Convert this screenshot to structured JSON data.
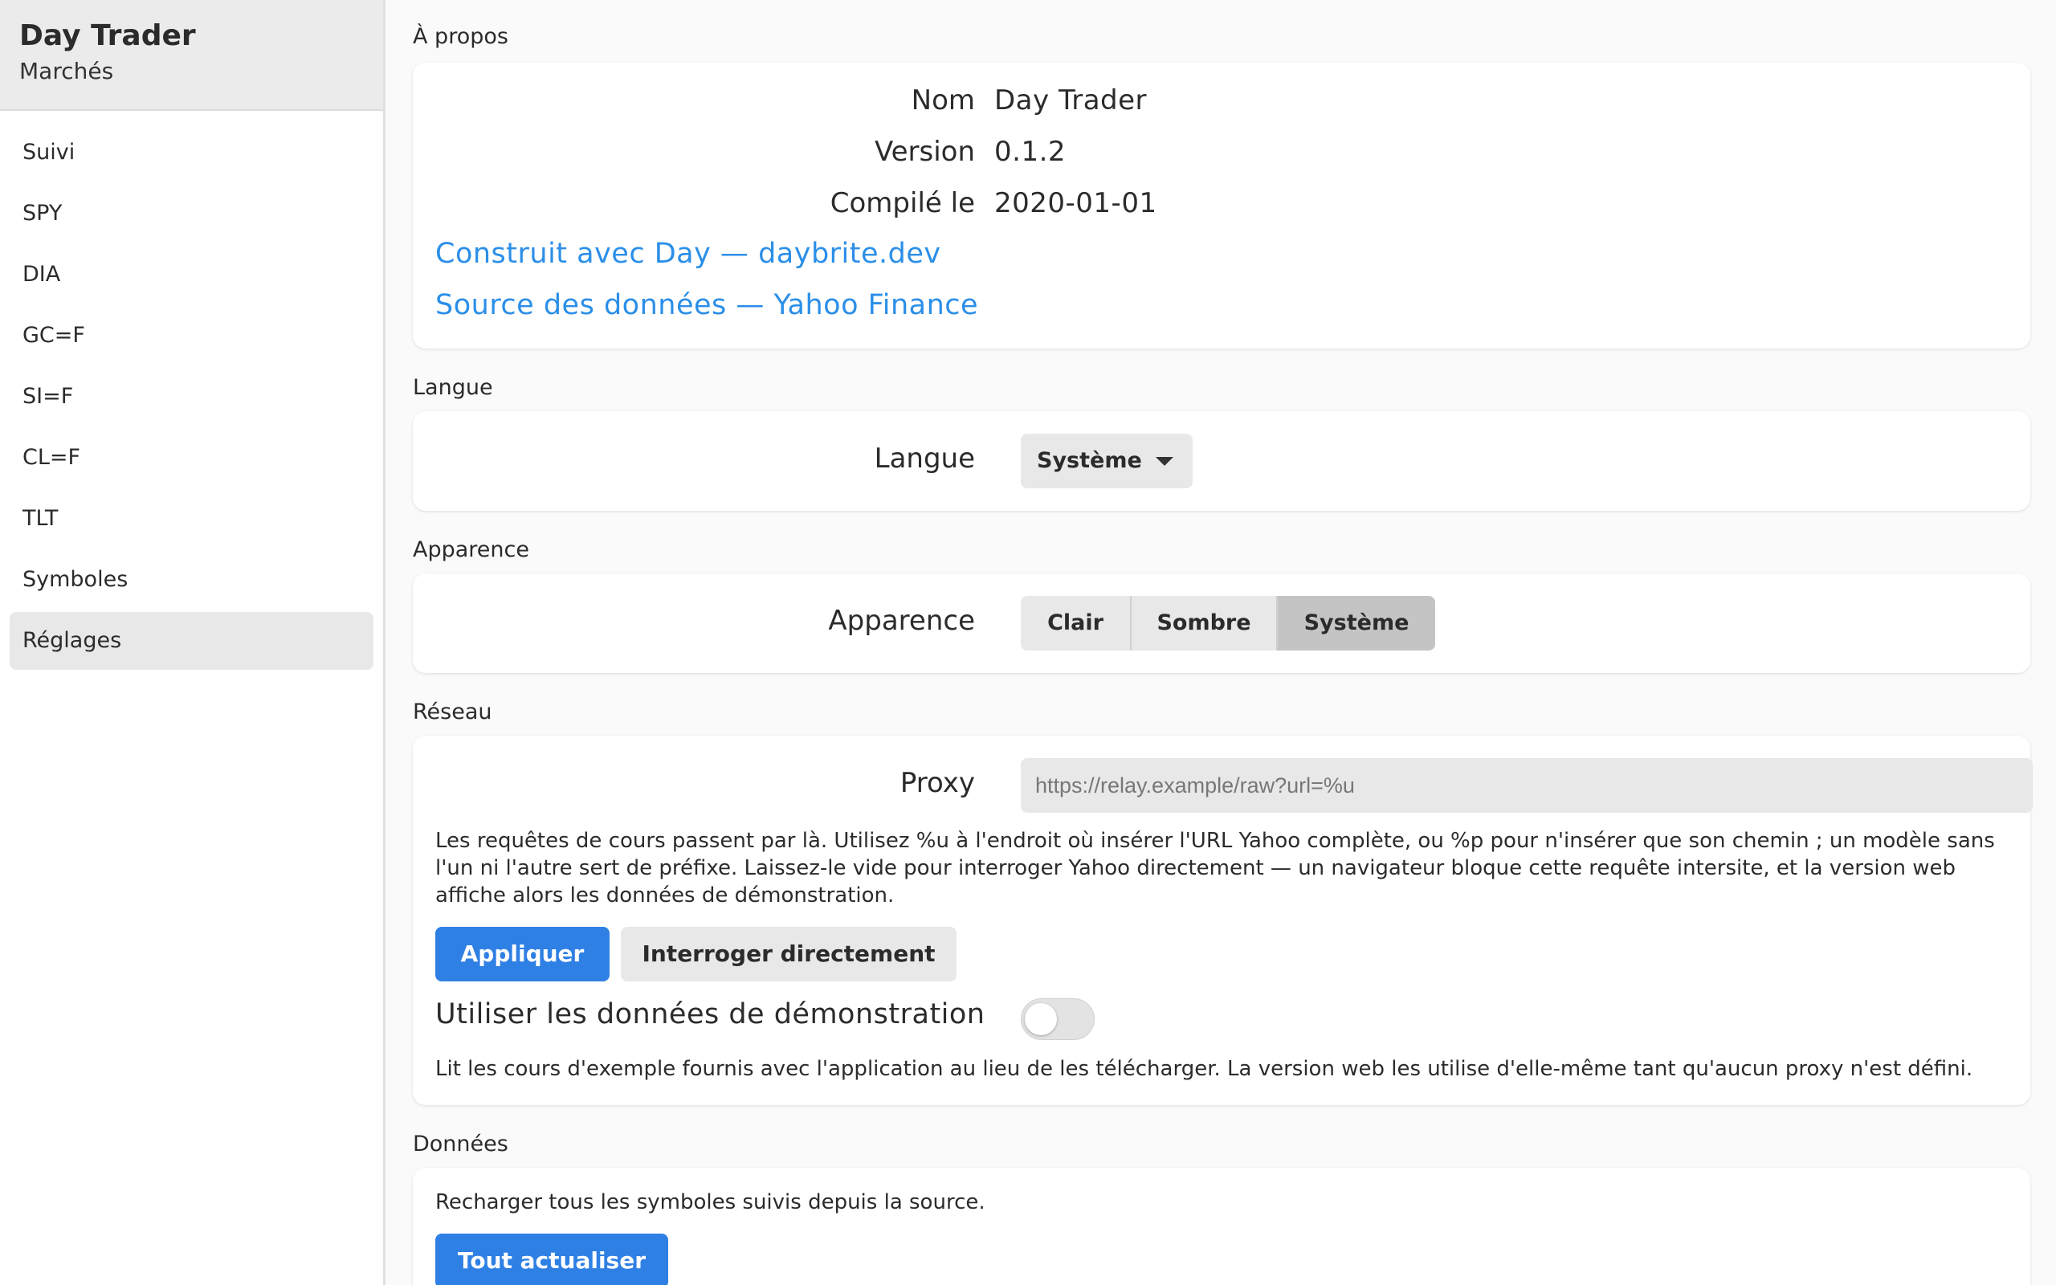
{
  "sidebar": {
    "title": "Day Trader",
    "subtitle": "Marchés",
    "items": [
      {
        "label": "Suivi"
      },
      {
        "label": "SPY"
      },
      {
        "label": "DIA"
      },
      {
        "label": "GC=F"
      },
      {
        "label": "SI=F"
      },
      {
        "label": "CL=F"
      },
      {
        "label": "TLT"
      },
      {
        "label": "Symboles"
      },
      {
        "label": "Réglages",
        "active": true
      }
    ]
  },
  "about": {
    "section": "À propos",
    "name_label": "Nom",
    "name_value": "Day Trader",
    "version_label": "Version",
    "version_value": "0.1.2",
    "compiled_label": "Compilé le",
    "compiled_value": "2020-01-01",
    "link_built": "Construit avec Day — daybrite.dev",
    "link_source": "Source des données — Yahoo Finance"
  },
  "language": {
    "section": "Langue",
    "label": "Langue",
    "selected": "Système"
  },
  "appearance": {
    "section": "Apparence",
    "label": "Apparence",
    "options": [
      "Clair",
      "Sombre",
      "Système"
    ],
    "selected": "Système"
  },
  "network": {
    "section": "Réseau",
    "proxy_label": "Proxy",
    "proxy_placeholder": "https://relay.example/raw?url=%u",
    "proxy_value": "",
    "help_lines": [
      "Les requêtes de cours passent par là. Utilisez %u à l'endroit où insérer l'URL Yahoo complète, ou %p pour n'insérer que son chemin ; un modèle sans",
      "l'un ni l'autre sert de préfixe. Laissez-le vide pour interroger Yahoo directement — un navigateur bloque cette requête intersite, et la version web",
      "affiche alors les données de démonstration."
    ],
    "apply_button": "Appliquer",
    "direct_button": "Interroger directement",
    "demo_label": "Utiliser les données de démonstration",
    "demo_enabled": false,
    "demo_help": "Lit les cours d'exemple fournis avec l'application au lieu de les télécharger. La version web les utilise d'elle-même tant qu'aucun proxy n'est défini."
  },
  "data": {
    "section": "Données",
    "description": "Recharger tous les symboles suivis depuis la source.",
    "refresh_button": "Tout actualiser"
  },
  "colors": {
    "accent": "#2f80e4",
    "link": "#2b8fe8"
  }
}
